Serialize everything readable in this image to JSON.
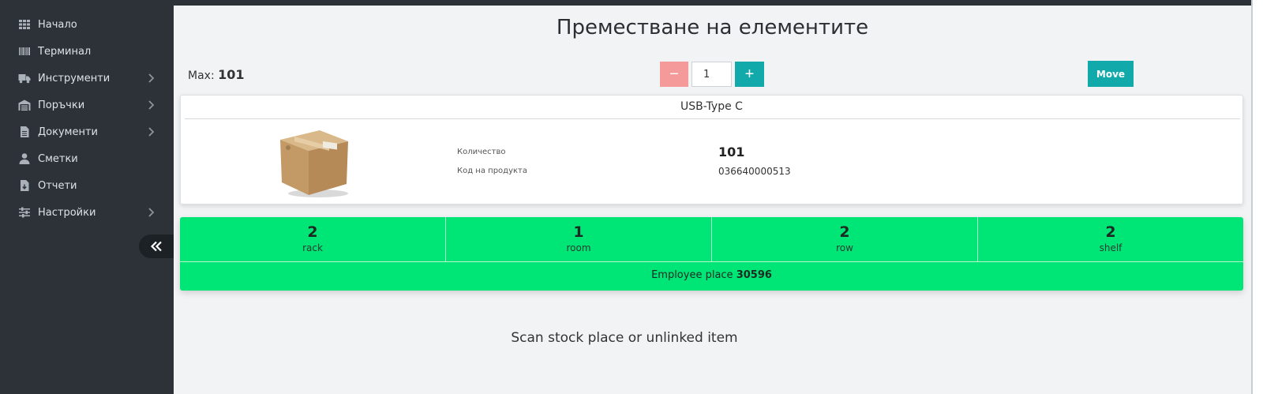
{
  "sidebar": {
    "items": [
      {
        "label": "Начало",
        "icon": "grid-icon",
        "has_submenu": false
      },
      {
        "label": "Терминал",
        "icon": "barcode-icon",
        "has_submenu": false
      },
      {
        "label": "Инструменти",
        "icon": "truck-icon",
        "has_submenu": true
      },
      {
        "label": "Поръчки",
        "icon": "warehouse-icon",
        "has_submenu": true
      },
      {
        "label": "Документи",
        "icon": "document-icon",
        "has_submenu": true
      },
      {
        "label": "Сметки",
        "icon": "user-icon",
        "has_submenu": false
      },
      {
        "label": "Отчети",
        "icon": "report-download-icon",
        "has_submenu": false
      },
      {
        "label": "Настройки",
        "icon": "sliders-icon",
        "has_submenu": true
      }
    ],
    "collapse_icon": "double-chevron-left-icon"
  },
  "page": {
    "title": "Преместване на елементите"
  },
  "controls": {
    "max_label": "Max:",
    "max_value": "101",
    "minus_label": "−",
    "quantity_value": "1",
    "plus_label": "+",
    "move_label": "Move"
  },
  "product": {
    "name": "USB-Type C",
    "image_icon": "cardboard-box-icon",
    "quantity_label": "Количество",
    "quantity_value": "101",
    "code_label": "Код на продукта",
    "code_value": "036640000513"
  },
  "location": {
    "cells": [
      {
        "value": "2",
        "caption": "rack"
      },
      {
        "value": "1",
        "caption": "room"
      },
      {
        "value": "2",
        "caption": "row"
      },
      {
        "value": "2",
        "caption": "shelf"
      }
    ],
    "employee_place_label": "Employee place",
    "employee_place_value": "30596",
    "color": "#00e676"
  },
  "scan_message": "Scan stock place or unlinked item",
  "colors": {
    "sidebar_bg": "#2c3238",
    "accent": "#12a9ab",
    "minus_button": "#f59a9a",
    "location_green": "#00e676"
  }
}
